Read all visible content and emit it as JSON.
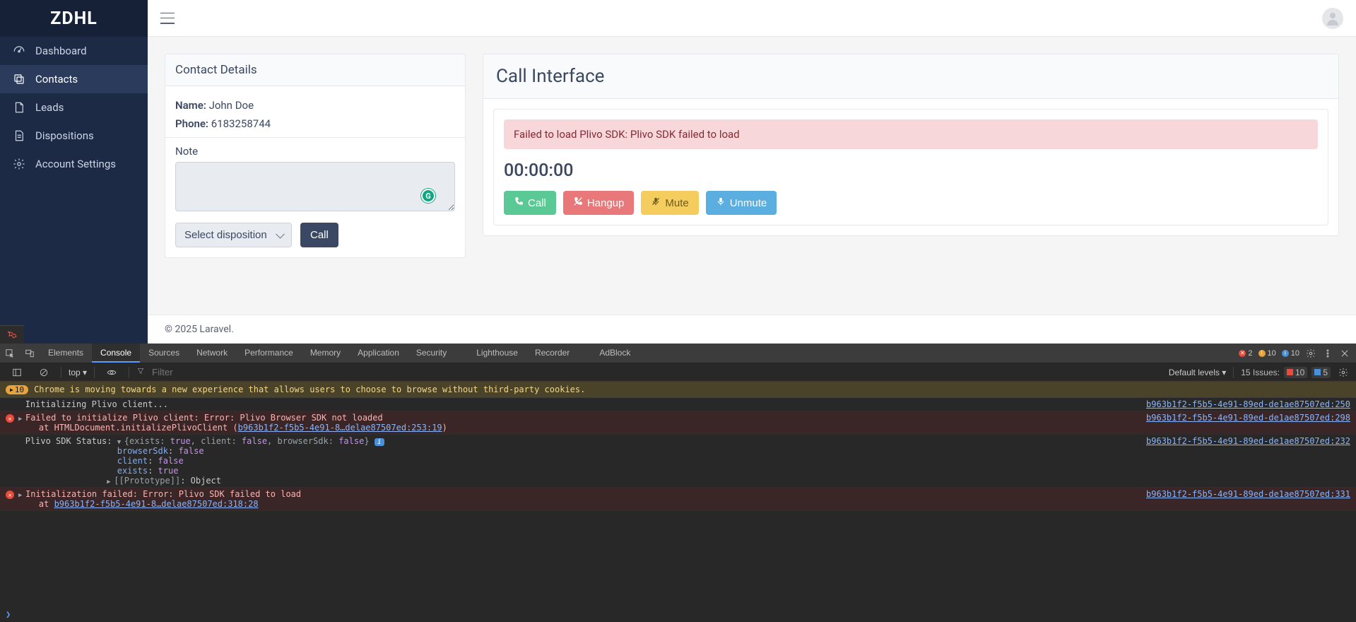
{
  "brand": "ZDHL",
  "sidebar": {
    "items": [
      {
        "label": "Dashboard",
        "icon": "gauge"
      },
      {
        "label": "Contacts",
        "icon": "copy",
        "active": true
      },
      {
        "label": "Leads",
        "icon": "doc"
      },
      {
        "label": "Dispositions",
        "icon": "doc-lines"
      },
      {
        "label": "Account Settings",
        "icon": "gear"
      }
    ]
  },
  "contact": {
    "header": "Contact Details",
    "name_label": "Name:",
    "name_value": "John Doe",
    "phone_label": "Phone:",
    "phone_value": "6183258744",
    "note_label": "Note",
    "disposition_placeholder": "Select disposition",
    "call_btn": "Call"
  },
  "call": {
    "header": "Call Interface",
    "alert": "Failed to load Plivo SDK: Plivo SDK failed to load",
    "timer": "00:00:00",
    "buttons": {
      "call": "Call",
      "hangup": "Hangup",
      "mute": "Mute",
      "unmute": "Unmute"
    }
  },
  "footer": "© 2025 Laravel.",
  "devtools": {
    "tabs": [
      "Elements",
      "Console",
      "Sources",
      "Network",
      "Performance",
      "Memory",
      "Application",
      "Security",
      "Lighthouse",
      "Recorder",
      "AdBlock"
    ],
    "active_tab": "Console",
    "badges": {
      "errors": "2",
      "warnings": "10",
      "info": "10"
    },
    "toolbar": {
      "top": "top",
      "filter_placeholder": "Filter",
      "default_levels": "Default levels",
      "issues_label": "15 Issues:",
      "issues_red": "10",
      "issues_blue": "5"
    },
    "banner": {
      "pill": "10",
      "text": "Chrome is moving towards a new experience that allows users to choose to browse without third-party cookies."
    },
    "log": [
      {
        "type": "plain",
        "text": "Initializing Plivo client...",
        "src": "b963b1f2-f5b5-4e91-89ed-de1ae87507ed:250"
      },
      {
        "type": "error",
        "arrow": "▶",
        "text": "Failed to initialize Plivo client: Error: Plivo Browser SDK not loaded",
        "src": "b963b1f2-f5b5-4e91-89ed-de1ae87507ed:298",
        "stack": "    at HTMLDocument.initializePlivoClient (",
        "stack_link": "b963b1f2-f5b5-4e91-8…delae87507ed:253:19",
        "stack_tail": ")"
      },
      {
        "type": "object",
        "prefix": "Plivo SDK Status: ",
        "arrow": "▼",
        "summary_pre": "{exists: ",
        "v1": "true",
        "s1": ", client: ",
        "v2": "false",
        "s2": ", browserSdk: ",
        "v3": "false",
        "s3": "}",
        "src": "b963b1f2-f5b5-4e91-89ed-de1ae87507ed:232",
        "props": [
          {
            "k": "browserSdk",
            "v": "false"
          },
          {
            "k": "client",
            "v": "false"
          },
          {
            "k": "exists",
            "v": "true"
          }
        ],
        "proto_k": "[[Prototype]]",
        "proto_v": "Object"
      },
      {
        "type": "error",
        "arrow": "▶",
        "text": "Initialization failed: Error: Plivo SDK failed to load",
        "src": "b963b1f2-f5b5-4e91-89ed-de1ae87507ed:331",
        "stack": "    at ",
        "stack_link": "b963b1f2-f5b5-4e91-8…delae87507ed:318:28",
        "stack_tail": ""
      }
    ]
  }
}
